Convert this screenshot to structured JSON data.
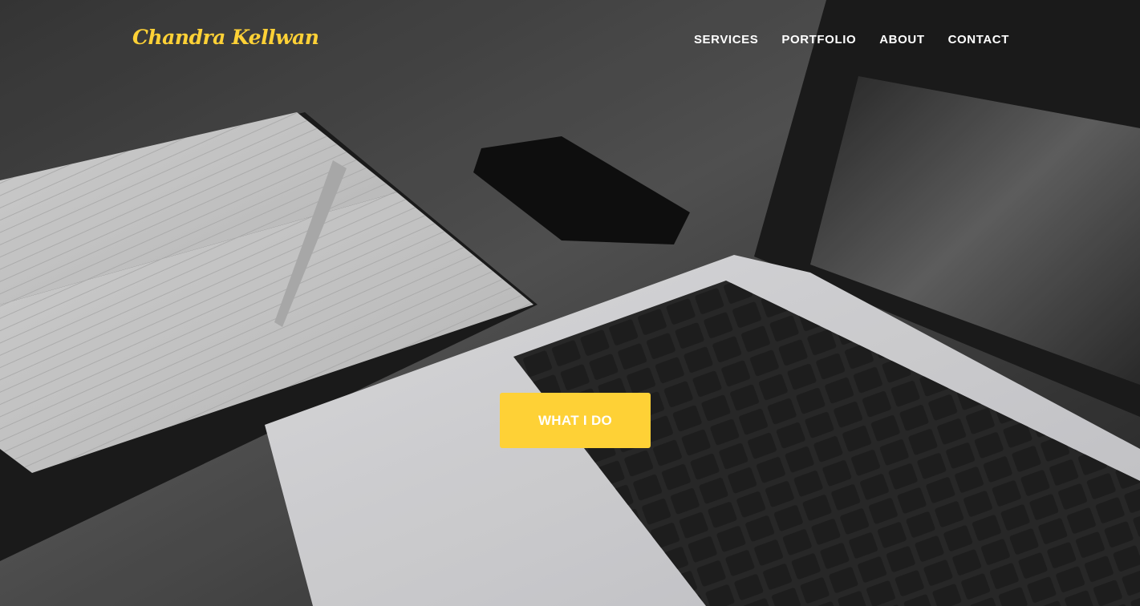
{
  "header": {
    "brand": "Chandra Kellwan",
    "nav": [
      {
        "label": "SERVICES"
      },
      {
        "label": "PORTFOLIO"
      },
      {
        "label": "ABOUT"
      },
      {
        "label": "CONTACT"
      }
    ]
  },
  "hero": {
    "cta_label": "WHAT I DO",
    "background_description_icon": "desk-photo"
  },
  "colors": {
    "accent": "#fed136",
    "nav_text": "#ffffff"
  }
}
